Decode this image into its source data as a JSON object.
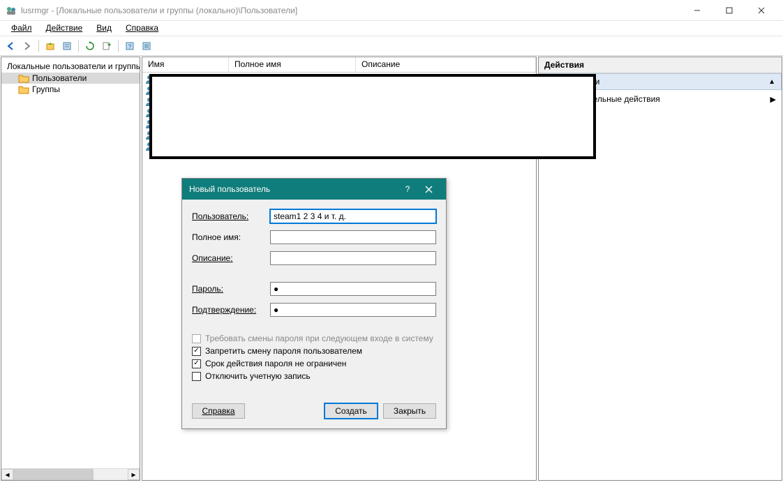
{
  "window": {
    "title": "lusrmgr - [Локальные пользователи и группы (локально)\\Пользователи]"
  },
  "menu": {
    "file": "Файл",
    "action": "Действие",
    "view": "Вид",
    "help": "Справка"
  },
  "tree": {
    "root": "Локальные пользователи и группы",
    "users": "Пользователи",
    "groups": "Группы"
  },
  "list_headers": {
    "name": "Имя",
    "fullname": "Полное имя",
    "description": "Описание"
  },
  "actions": {
    "header": "Действия",
    "group": "Пользователи",
    "more": "Дополнительные действия"
  },
  "dialog": {
    "title": "Новый пользователь",
    "help_char": "?",
    "user_label": "Пользователь:",
    "user_value": "steam1 2 3 4 и т. д.",
    "fullname_label": "Полное имя:",
    "fullname_value": "",
    "description_label": "Описание:",
    "description_value": "",
    "password_label": "Пароль:",
    "password_value": "●",
    "confirm_label": "Подтверждение:",
    "confirm_value": "●",
    "chk_require": "Требовать смены пароля при следующем входе в систему",
    "chk_nochange": "Запретить смену пароля пользователем",
    "chk_noexpire": "Срок действия пароля не ограничен",
    "chk_disable": "Отключить учетную запись",
    "btn_help": "Справка",
    "btn_create": "Создать",
    "btn_close": "Закрыть"
  }
}
